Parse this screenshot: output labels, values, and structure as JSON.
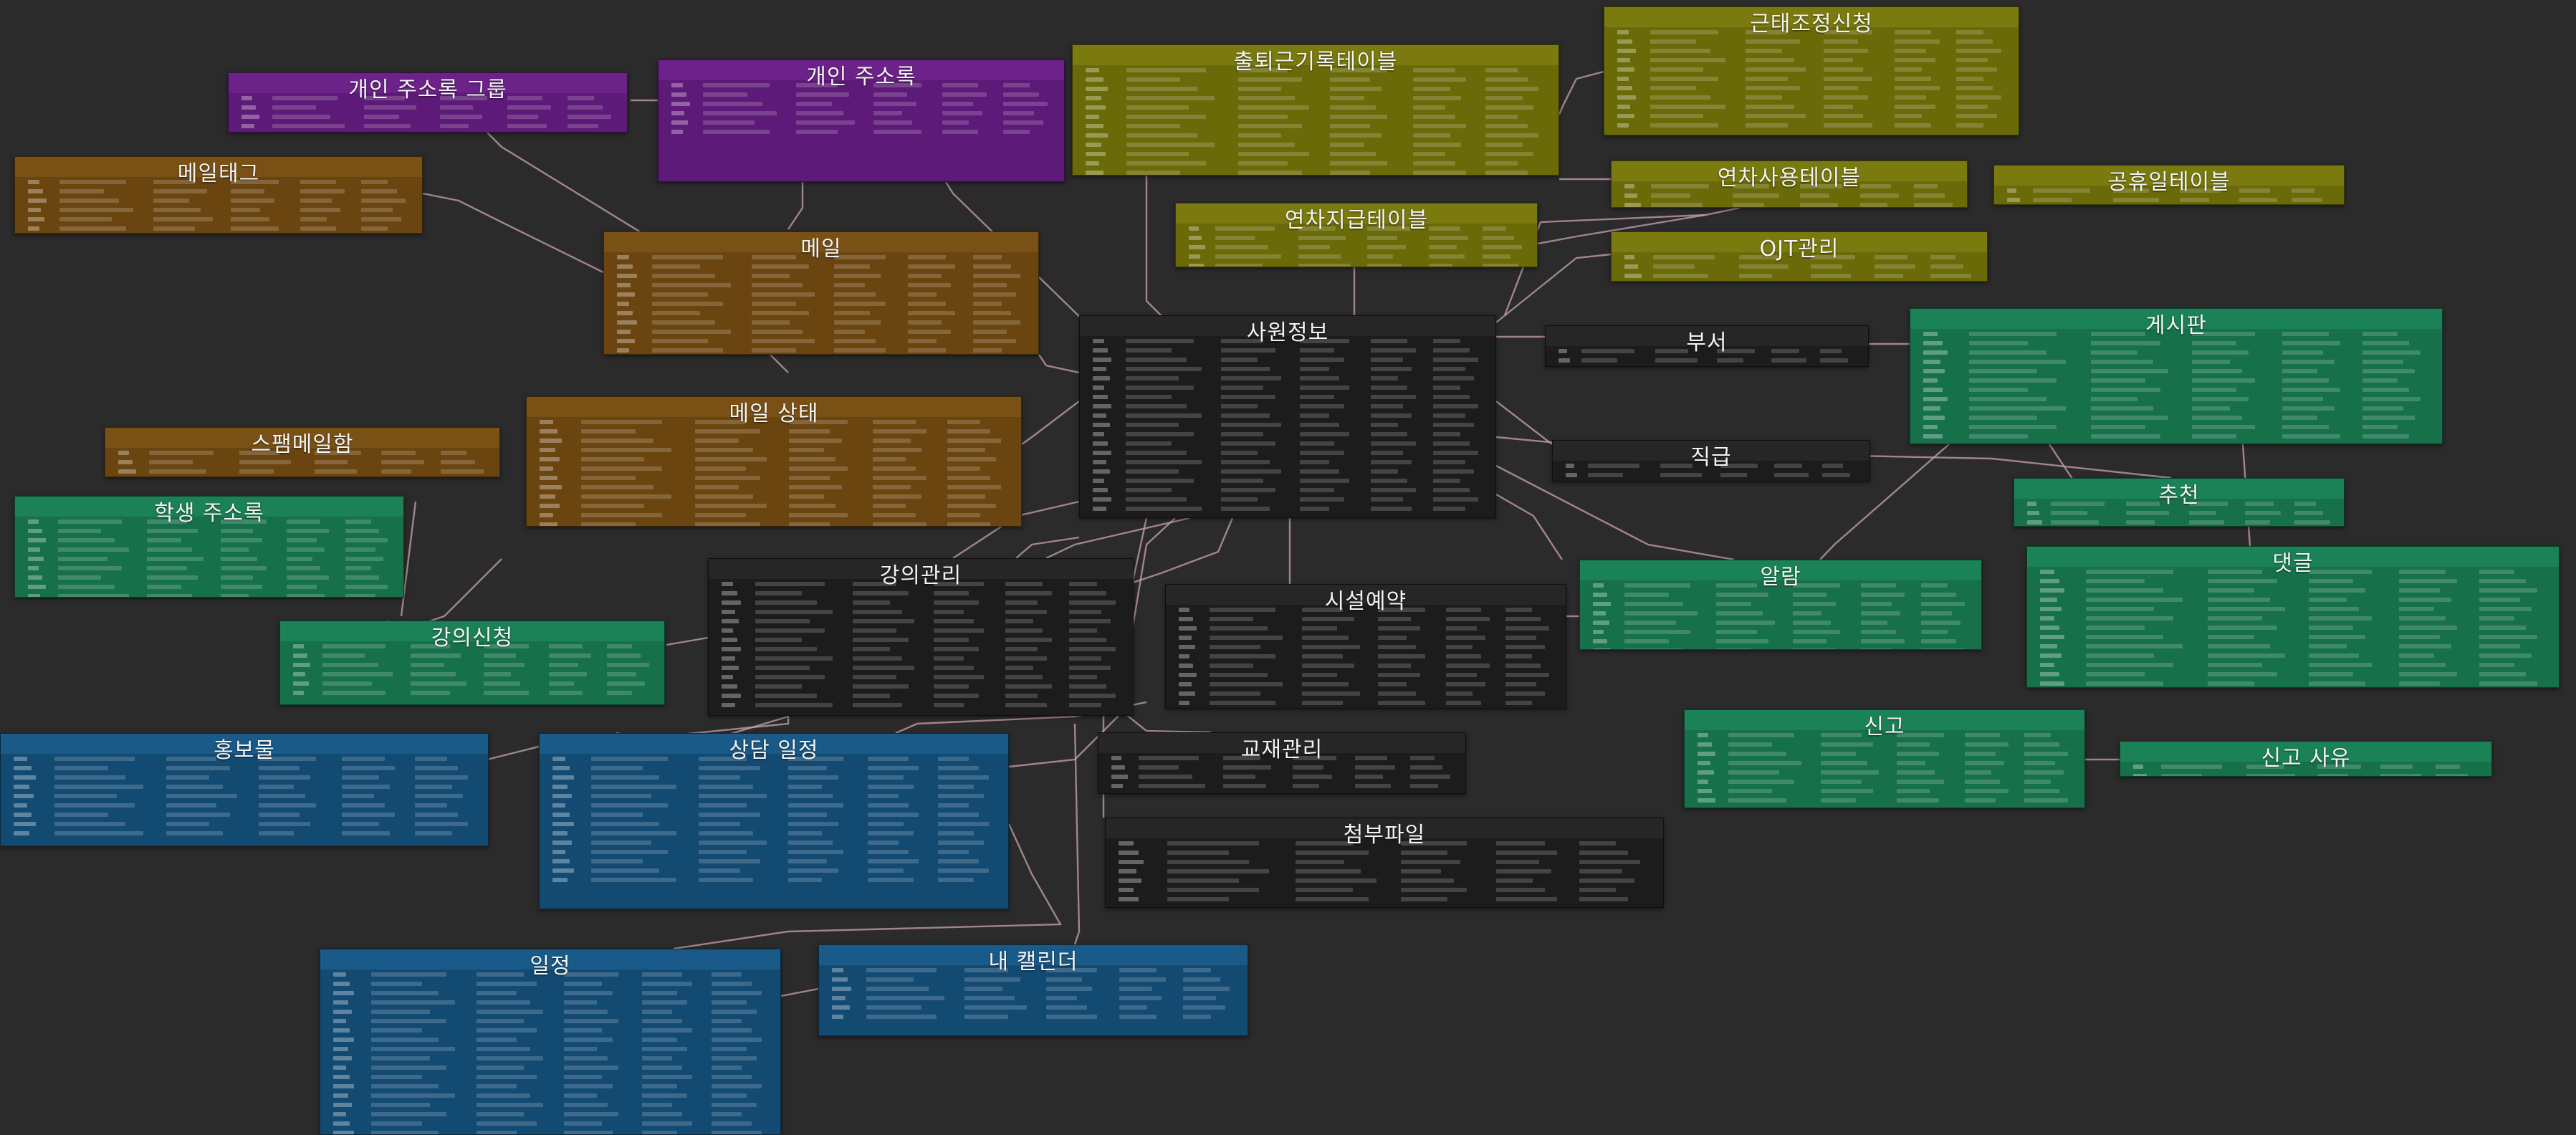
{
  "diagram": {
    "background": "#2b2b2b",
    "edge_color": "#c9a3ad",
    "tables": [
      {
        "id": "personal-addressbook-group",
        "title": "개인 주소록 그룹",
        "theme": "purple"
      },
      {
        "id": "personal-addressbook",
        "title": "개인 주소록",
        "theme": "purple"
      },
      {
        "id": "attendance-log",
        "title": "출퇴근기록테이블",
        "theme": "olive"
      },
      {
        "id": "attendance-adjust",
        "title": "근태조정신청",
        "theme": "olive"
      },
      {
        "id": "mail-tag",
        "title": "메일태그",
        "theme": "brown"
      },
      {
        "id": "annual-usage",
        "title": "연차사용테이블",
        "theme": "olive"
      },
      {
        "id": "holiday",
        "title": "공휴일테이블",
        "theme": "olive"
      },
      {
        "id": "annual-grant",
        "title": "연차지급테이블",
        "theme": "olive"
      },
      {
        "id": "ojt",
        "title": "OJT관리",
        "theme": "olive"
      },
      {
        "id": "mail",
        "title": "메일",
        "theme": "brown"
      },
      {
        "id": "employee",
        "title": "사원정보",
        "theme": "dark"
      },
      {
        "id": "department",
        "title": "부서",
        "theme": "dark"
      },
      {
        "id": "board",
        "title": "게시판",
        "theme": "green"
      },
      {
        "id": "mail-status",
        "title": "메일 상태",
        "theme": "brown"
      },
      {
        "id": "spam-mail",
        "title": "스팸메일함",
        "theme": "brown"
      },
      {
        "id": "position",
        "title": "직급",
        "theme": "dark"
      },
      {
        "id": "recommend",
        "title": "추천",
        "theme": "green"
      },
      {
        "id": "student-addressbook",
        "title": "학생 주소록",
        "theme": "green"
      },
      {
        "id": "alarm",
        "title": "알람",
        "theme": "green"
      },
      {
        "id": "comment",
        "title": "댓글",
        "theme": "green"
      },
      {
        "id": "lecture",
        "title": "강의관리",
        "theme": "dark"
      },
      {
        "id": "facility",
        "title": "시설예약",
        "theme": "dark"
      },
      {
        "id": "lecture-apply",
        "title": "강의신청",
        "theme": "green"
      },
      {
        "id": "promotion",
        "title": "홍보물",
        "theme": "blue"
      },
      {
        "id": "counsel",
        "title": "상담 일정",
        "theme": "blue"
      },
      {
        "id": "textbook",
        "title": "교재관리",
        "theme": "dark"
      },
      {
        "id": "report",
        "title": "신고",
        "theme": "green"
      },
      {
        "id": "report-reason",
        "title": "신고 사유",
        "theme": "green"
      },
      {
        "id": "attachment",
        "title": "첨부파일",
        "theme": "dark"
      },
      {
        "id": "schedule",
        "title": "일정",
        "theme": "blue"
      },
      {
        "id": "my-calendar",
        "title": "내 캘린더",
        "theme": "blue"
      }
    ]
  }
}
